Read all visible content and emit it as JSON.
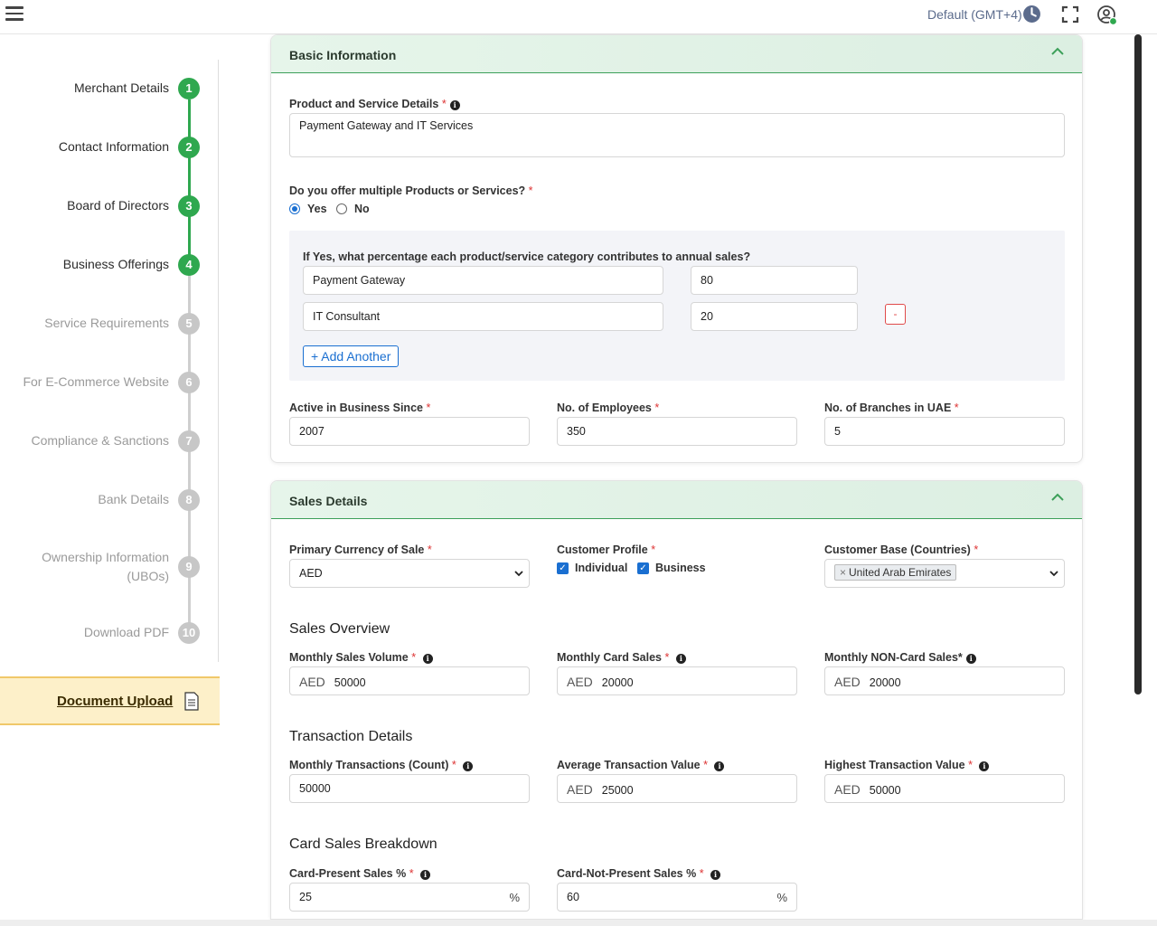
{
  "header": {
    "timezone": "Default (GMT+4)",
    "menu_icon": "hamburger-icon",
    "clock_icon": "clock-icon",
    "fullscreen_icon": "fullscreen-icon",
    "user_icon": "user-icon"
  },
  "sidebar": {
    "steps": [
      {
        "label": "Merchant Details",
        "num": "1"
      },
      {
        "label": "Contact Information",
        "num": "2"
      },
      {
        "label": "Board of Directors",
        "num": "3"
      },
      {
        "label": "Business Offerings",
        "num": "4"
      },
      {
        "label": "Service Requirements",
        "num": "5"
      },
      {
        "label": "For E-Commerce Website",
        "num": "6"
      },
      {
        "label": "Compliance & Sanctions",
        "num": "7"
      },
      {
        "label": "Bank Details",
        "num": "8"
      },
      {
        "label": "Ownership Information",
        "label2": "(UBOs)",
        "num": "9"
      },
      {
        "label": "Download PDF",
        "num": "10"
      }
    ],
    "document_upload": "Document Upload"
  },
  "colors": {
    "completed": "#2fa84f",
    "pending": "#c7c7c7",
    "accent": "#1a6fd1"
  },
  "basic_info": {
    "title": "Basic Information",
    "product_label": "Product and Service Details",
    "product_value": "Payment Gateway and IT Services",
    "multiple_label": "Do you offer multiple Products or Services?",
    "yes": "Yes",
    "no": "No",
    "selected": "Yes",
    "breakdown_label": "If Yes, what percentage each product/service category contributes to annual sales?",
    "rows": [
      {
        "name": "Payment Gateway",
        "pct": "80"
      },
      {
        "name": "IT Consultant",
        "pct": "20"
      }
    ],
    "remove_label": "-",
    "add_label": "+ Add Another",
    "since_label": "Active in Business Since",
    "since_value": "2007",
    "employees_label": "No. of Employees",
    "employees_value": "350",
    "branches_label": "No. of Branches in UAE",
    "branches_value": "5"
  },
  "sales": {
    "title": "Sales Details",
    "currency_label": "Primary Currency of Sale",
    "currency_value": "AED",
    "profile_label": "Customer Profile",
    "individual": "Individual",
    "business": "Business",
    "base_label": "Customer Base (Countries)",
    "base_tag": "United Arab Emirates",
    "overview_title": "Sales Overview",
    "monthly_volume_label": "Monthly Sales Volume",
    "monthly_volume": "50000",
    "monthly_card_label": "Monthly Card Sales",
    "monthly_card": "20000",
    "monthly_noncard_label": "Monthly NON-Card Sales*",
    "monthly_noncard": "20000",
    "currency_prefix": "AED",
    "tx_title": "Transaction Details",
    "tx_count_label": "Monthly Transactions (Count)",
    "tx_count": "50000",
    "avg_label": "Average Transaction Value",
    "avg_value": "25000",
    "highest_label": "Highest Transaction Value",
    "highest_value": "50000",
    "card_breakdown_title": "Card Sales Breakdown",
    "cp_label": "Card-Present Sales %",
    "cp_value": "25",
    "cnp_label": "Card-Not-Present Sales %",
    "cnp_value": "60",
    "pct_suffix": "%"
  }
}
